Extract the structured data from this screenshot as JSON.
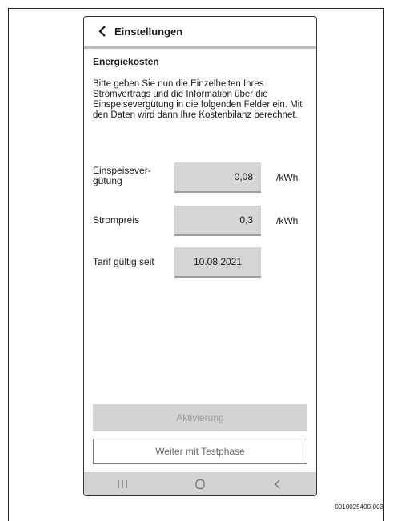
{
  "header": {
    "title": "Einstellungen",
    "back_icon": "chevron-left-icon"
  },
  "section_title": "Energiekosten",
  "description": "Bitte geben Sie nun die Einzelheiten Ihres Stromvertrags und die Information über die Einspeisevergütung in die folgenden Felder ein. Mit den Daten wird dann Ihre Kostenbilanz berechnet.",
  "fields": [
    {
      "label_line1": "Einspeisever-",
      "label_line2": "gütung",
      "value": "0,08",
      "unit": "/kWh"
    },
    {
      "label": "Strompreis",
      "value": "0,3",
      "unit": "/kWh"
    },
    {
      "label": "Tarif gültig seit",
      "value": "10.08.2021"
    }
  ],
  "buttons": {
    "activate": "Aktivierung",
    "test_phase": "Weiter mit Testphase"
  },
  "navbar": {
    "icons": [
      "recent-apps-icon",
      "home-icon",
      "back-icon"
    ]
  },
  "caption": "0010025400-003",
  "colors": {
    "field_bg": "#d6d6d6",
    "button_disabled_bg": "#d3d3d3",
    "header_bar": "#bdbdbd"
  }
}
